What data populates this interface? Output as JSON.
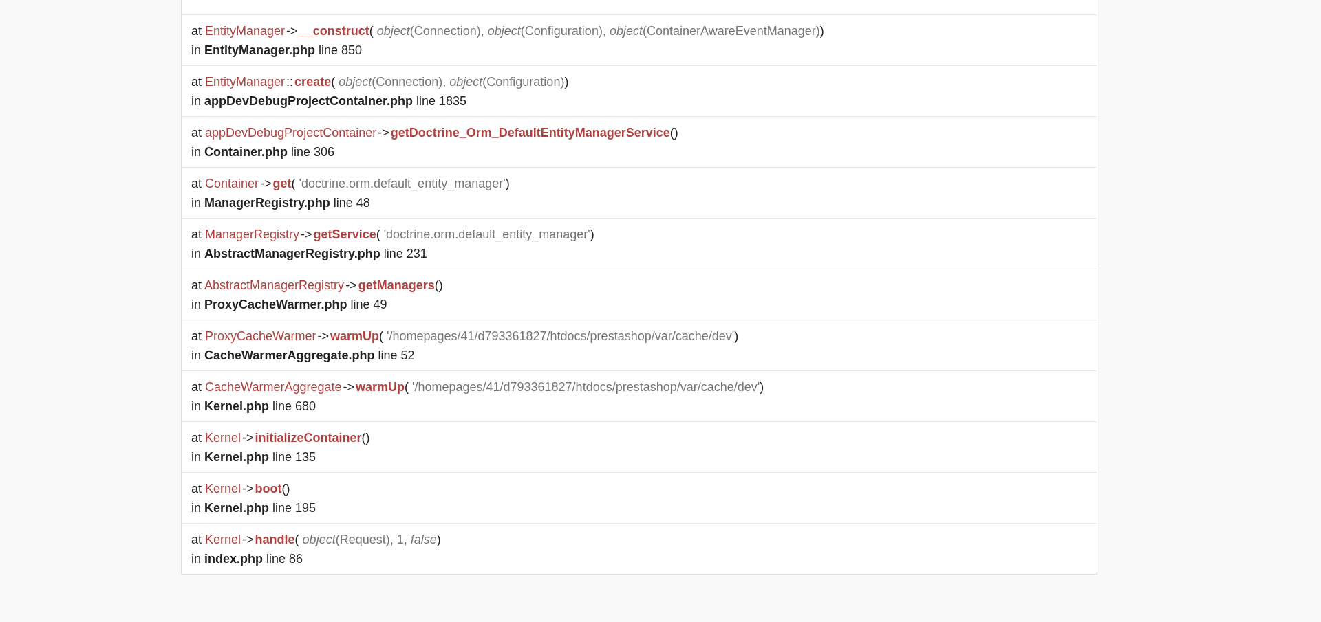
{
  "frames": [
    {
      "call": {
        "at": "at",
        "class": "EntityManager",
        "type": "->",
        "method": "__construct",
        "open": "(",
        "args": " *object*(Connection), *object*(Configuration), *object*(ContainerAwareEventManager)",
        "close": ")"
      },
      "location": "in **EntityManager.php** line 850"
    },
    {
      "call": {
        "at": "at",
        "class": "EntityManager",
        "type": "::",
        "method": "create",
        "open": "(",
        "args": " *object*(Connection), *object*(Configuration)",
        "close": ")"
      },
      "location": "in **appDevDebugProjectContainer.php** line 1835"
    },
    {
      "call": {
        "at": "at",
        "class": "appDevDebugProjectContainer",
        "type": "->",
        "method": "getDoctrine_Orm_DefaultEntityManagerService",
        "open": "(",
        "close": ")"
      },
      "location": "in **Container.php** line 306"
    },
    {
      "call": {
        "at": "at",
        "class": "Container",
        "type": "->",
        "method": "get",
        "open": "(",
        "args": " 'doctrine.orm.default_entity_manager'",
        "close": ")"
      },
      "location": "in **ManagerRegistry.php** line 48"
    },
    {
      "call": {
        "at": "at",
        "class": "ManagerRegistry",
        "type": "->",
        "method": "getService",
        "open": "(",
        "args": " 'doctrine.orm.default_entity_manager'",
        "close": ")"
      },
      "location": "in **AbstractManagerRegistry.php** line 231"
    },
    {
      "call": {
        "at": "at",
        "class": "AbstractManagerRegistry",
        "type": "->",
        "method": "getManagers",
        "open": "(",
        "close": ")"
      },
      "location": "in **ProxyCacheWarmer.php** line 49"
    },
    {
      "call": {
        "at": "at",
        "class": "ProxyCacheWarmer",
        "type": "->",
        "method": "warmUp",
        "open": "(",
        "args": " '/homepages/41/d793361827/htdocs/prestashop/var/cache/dev'",
        "close": ")"
      },
      "location": "in **CacheWarmerAggregate.php** line 52"
    },
    {
      "call": {
        "at": "at",
        "class": "CacheWarmerAggregate",
        "type": "->",
        "method": "warmUp",
        "open": "(",
        "args": " '/homepages/41/d793361827/htdocs/prestashop/var/cache/dev'",
        "close": ")"
      },
      "location": "in **Kernel.php** line 680"
    },
    {
      "call": {
        "at": "at",
        "class": "Kernel",
        "type": "->",
        "method": "initializeContainer",
        "open": "(",
        "close": ")"
      },
      "location": "in **Kernel.php** line 135"
    },
    {
      "call": {
        "at": "at",
        "class": "Kernel",
        "type": "->",
        "method": "boot",
        "open": "(",
        "close": ")"
      },
      "location": "in **Kernel.php** line 195"
    },
    {
      "call": {
        "at": "at",
        "class": "Kernel",
        "type": "->",
        "method": "handle",
        "open": "(",
        "args": " *object*(Request), 1, *false*",
        "close": ")"
      },
      "location": "in **index.php** line 86"
    }
  ]
}
